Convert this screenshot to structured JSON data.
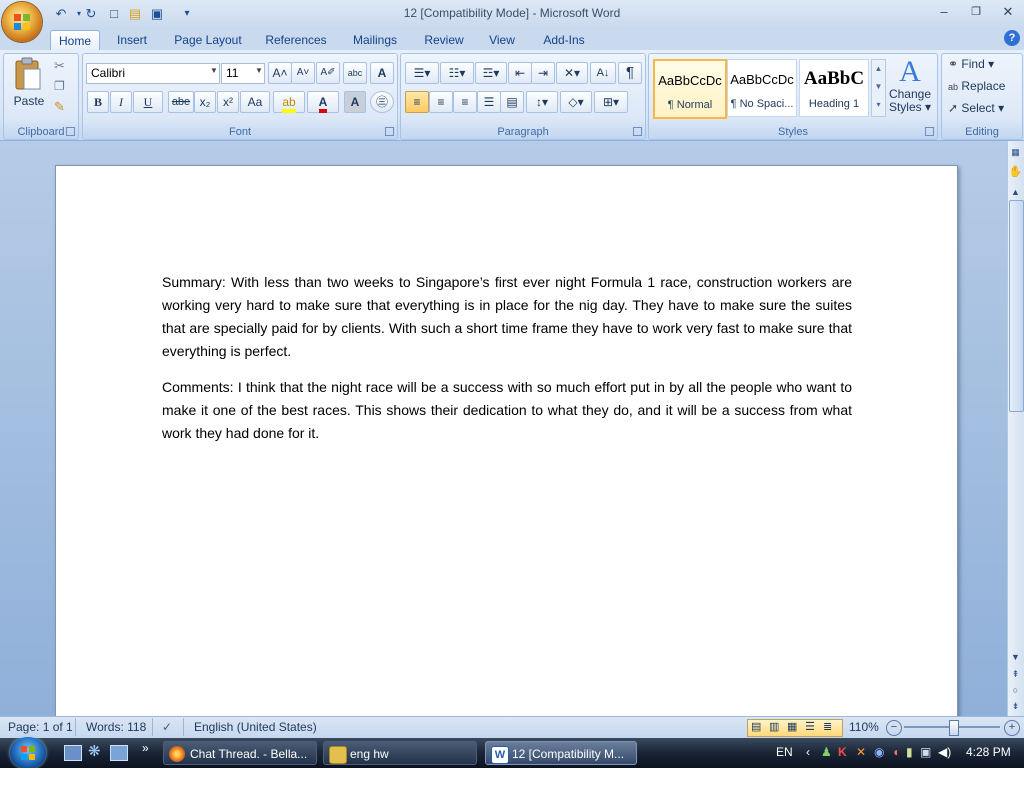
{
  "window": {
    "title": "12 [Compatibility Mode] - Microsoft Word",
    "minimize": "–",
    "restore": "❐",
    "close": "✕"
  },
  "quick_access": {
    "undo": "↶",
    "redo": "↻",
    "new": "□",
    "open": "▤",
    "save": "▣",
    "customize": "▾"
  },
  "tabs": [
    "Home",
    "Insert",
    "Page Layout",
    "References",
    "Mailings",
    "Review",
    "View",
    "Add-Ins"
  ],
  "ribbon": {
    "clipboard": {
      "label": "Clipboard",
      "paste": "Paste"
    },
    "font": {
      "label": "Font",
      "name": "Calibri",
      "size": "11",
      "grow": "A˄",
      "shrink": "A˅",
      "bold": "B",
      "italic": "I",
      "underline": "U",
      "strike": "abe",
      "subscript": "x₂",
      "superscript": "x²",
      "case": "Aa",
      "clear": "A",
      "text_effects": "A"
    },
    "paragraph": {
      "label": "Paragraph",
      "pilcrow": "¶",
      "sort": "A↓"
    },
    "styles": {
      "label": "Styles",
      "items": [
        {
          "sample": "AaBbCcDc",
          "name": "¶ Normal"
        },
        {
          "sample": "AaBbCcDc",
          "name": "¶ No Spaci..."
        },
        {
          "sample": "AaBbC",
          "name": "Heading 1"
        }
      ],
      "change_styles_line1": "Change",
      "change_styles_line2": "Styles ▾"
    },
    "editing": {
      "label": "Editing",
      "find": "Find ▾",
      "replace": "Replace",
      "select": "Select ▾"
    }
  },
  "document": {
    "summary": "Summary: With less than two weeks to Singapore’s first ever night Formula 1 race, construction workers are working very hard to make sure that everything is in place for the nig day. They have to make sure the suites that are specially paid for by clients. With such a short time frame they have to work very fast to make sure that everything is perfect.",
    "comments": "Comments: I think that the night race will be a success with so much effort put in by all the people who want to make it one of the best races. This shows their dedication to what they do, and it will be a success from what work they had done for it."
  },
  "status": {
    "page": "Page: 1 of 1",
    "words": "Words: 118",
    "language": "English (United States)",
    "zoom": "110%",
    "zoom_level": 110
  },
  "taskbar": {
    "tasks": [
      "Chat Thread. - Bella...",
      "eng hw",
      "12 [Compatibility M..."
    ],
    "lang": "EN",
    "time": "4:28 PM"
  },
  "colors": {
    "accent": "#15428b",
    "ribbon": "#dde8f7",
    "doc_bg": "#9fbce2"
  }
}
